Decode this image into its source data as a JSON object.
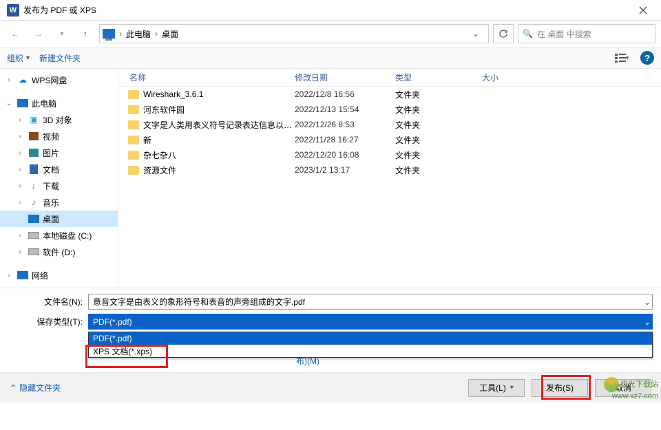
{
  "titlebar": {
    "title": "发布为 PDF 或 XPS",
    "app_glyph": "W"
  },
  "breadcrumb": {
    "seg1": "此电脑",
    "seg2": "桌面"
  },
  "search": {
    "placeholder": "在 桌面 中搜索"
  },
  "toolbar": {
    "organize": "组织",
    "newfolder": "新建文件夹"
  },
  "sidebar": {
    "wps": "WPS网盘",
    "thispc": "此电脑",
    "items": [
      {
        "label": "3D 对象"
      },
      {
        "label": "视频"
      },
      {
        "label": "图片"
      },
      {
        "label": "文档"
      },
      {
        "label": "下载"
      },
      {
        "label": "音乐"
      },
      {
        "label": "桌面"
      },
      {
        "label": "本地磁盘 (C:)"
      },
      {
        "label": "软件 (D:)"
      }
    ],
    "network": "网络"
  },
  "headers": {
    "name": "名称",
    "date": "修改日期",
    "type": "类型",
    "size": "大小"
  },
  "files": [
    {
      "name": "Wireshark_3.6.1",
      "date": "2022/12/8 16:56",
      "type": "文件夹"
    },
    {
      "name": "河东软件园",
      "date": "2022/12/13 15:54",
      "type": "文件夹"
    },
    {
      "name": "文字是人类用表义符号记录表达信息以传...",
      "date": "2022/12/26 8:53",
      "type": "文件夹"
    },
    {
      "name": "新",
      "date": "2022/11/28 16:27",
      "type": "文件夹"
    },
    {
      "name": "杂七杂八",
      "date": "2022/12/20 16:08",
      "type": "文件夹"
    },
    {
      "name": "资源文件",
      "date": "2023/1/2 13:17",
      "type": "文件夹"
    }
  ],
  "form": {
    "filename_lbl": "文件名(N):",
    "filename_val": "意音文字是由表义的象形符号和表音的声旁组成的文字.pdf",
    "savetype_lbl": "保存类型(T):",
    "savetype_val": "PDF(*.pdf)",
    "options": [
      {
        "label": "PDF(*.pdf)",
        "selected": true
      },
      {
        "label": "XPS 文档(*.xps)",
        "selected": false
      }
    ],
    "radio_min": "最小文件大小(联机发布)(M)"
  },
  "footer": {
    "hide": "隐藏文件夹",
    "tools": "工具(L)",
    "publish": "发布(S)",
    "cancel": "取消"
  },
  "watermark": {
    "line1": "极光下载站",
    "line2": "www.xz7.com"
  }
}
